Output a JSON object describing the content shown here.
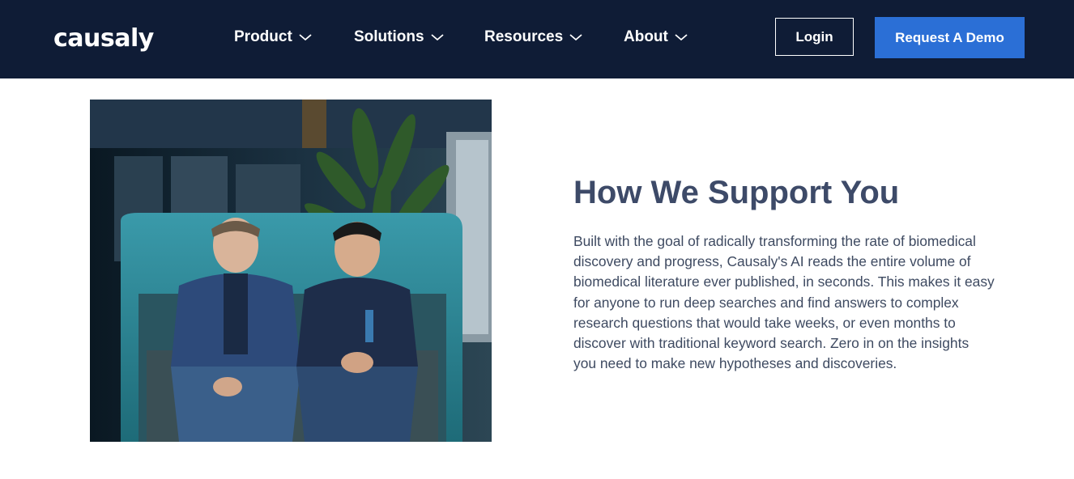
{
  "header": {
    "logo_text": "causaly",
    "nav": [
      {
        "label": "Product",
        "icon": "chevron-down-icon"
      },
      {
        "label": "Solutions",
        "icon": "chevron-down-icon"
      },
      {
        "label": "Resources",
        "icon": "chevron-down-icon"
      },
      {
        "label": "About",
        "icon": "chevron-down-icon"
      }
    ],
    "login_label": "Login",
    "demo_label": "Request A Demo"
  },
  "main": {
    "title": "How We Support You",
    "paragraph": "Built with the goal of radically transforming the rate of biomedical discovery and progress, Causaly's AI reads the entire volume of biomedical literature ever published, in seconds. This makes it easy for anyone to run deep searches and find answers to complex research questions that would take weeks, or even months to discover with traditional keyword search. Zero in on the insights you need to make new hypotheses and discoveries."
  },
  "colors": {
    "nav_bg": "#0f1c36",
    "accent": "#2b6fd6",
    "heading": "#3d4a68",
    "text": "#3e4a61"
  }
}
